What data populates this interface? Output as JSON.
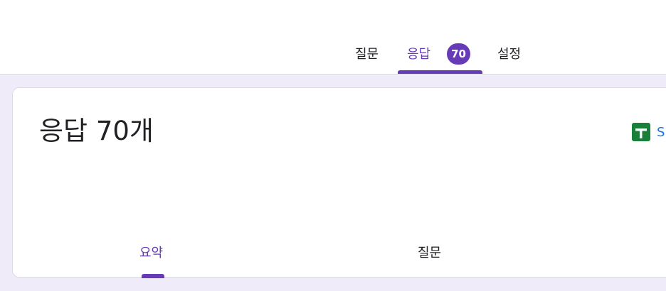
{
  "header": {
    "star_icon": "star-outline-icon",
    "tabs": [
      {
        "label": "질문"
      },
      {
        "label": "응답"
      },
      {
        "label": "설정"
      }
    ],
    "response_count_badge": "70",
    "active_tab_color": "#673ab7"
  },
  "card": {
    "title": "응답 70개",
    "sheets_icon": "google-sheets-icon",
    "sheets_text": "S",
    "subtabs": [
      {
        "label": "요약"
      },
      {
        "label": "질문"
      }
    ]
  },
  "colors": {
    "accent": "#673ab7",
    "background": "#f0ebf8",
    "sheets_green": "#188038",
    "link_blue": "#1a73e8"
  }
}
